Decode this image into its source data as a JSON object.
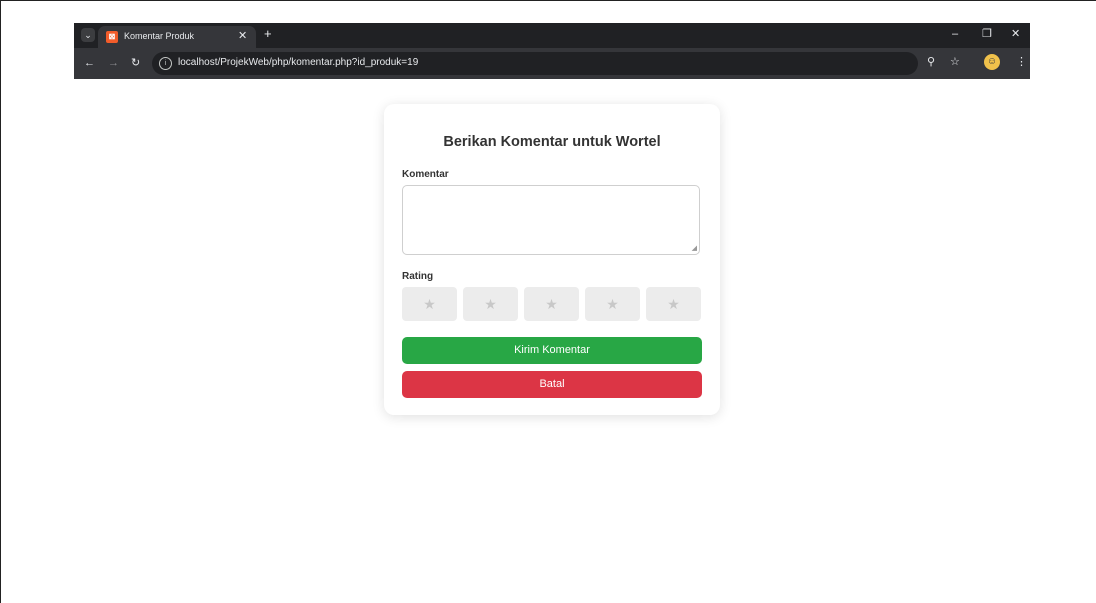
{
  "browser": {
    "tab_title": "Komentar Produk",
    "url": "localhost/ProjekWeb/php/komentar.php?id_produk=19",
    "icons": {
      "tab_search": "chevron-down-icon",
      "favicon": "xampp-favicon",
      "tab_close": "close-icon",
      "new_tab": "plus-icon",
      "minimize": "minimize-icon",
      "restore": "restore-icon",
      "close": "close-icon",
      "back": "arrow-left-icon",
      "forward": "arrow-right-icon",
      "reload": "reload-icon",
      "site_info": "info-icon",
      "zoom": "zoom-icon",
      "bookmark": "star-icon",
      "profile": "profile-icon",
      "menu": "more-vertical-icon"
    }
  },
  "form": {
    "title": "Berikan Komentar untuk Wortel",
    "comment_label": "Komentar",
    "comment_value": "",
    "rating_label": "Rating",
    "stars": [
      "★",
      "★",
      "★",
      "★",
      "★"
    ],
    "rating_value": 0,
    "submit_label": "Kirim Komentar",
    "cancel_label": "Batal"
  },
  "colors": {
    "submit": "#28a745",
    "cancel": "#dc3545",
    "star_bg": "#ececec",
    "browser_chrome": "#202124"
  }
}
